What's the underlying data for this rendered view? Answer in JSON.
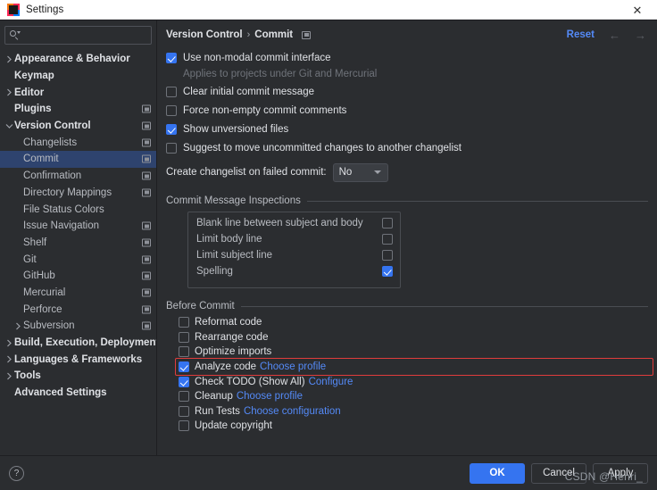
{
  "window": {
    "title": "Settings",
    "close_icon": "close-icon",
    "app_icon": "intellij-idea-icon"
  },
  "search": {
    "placeholder": "",
    "value": "",
    "icon": "search-icon"
  },
  "sidebar": {
    "items": [
      {
        "label": "Appearance & Behavior",
        "level": 0,
        "arrow": "right",
        "bold": true,
        "config_icon": false,
        "selected": false
      },
      {
        "label": "Keymap",
        "level": 0,
        "arrow": "none",
        "bold": true,
        "config_icon": false,
        "selected": false
      },
      {
        "label": "Editor",
        "level": 0,
        "arrow": "right",
        "bold": true,
        "config_icon": false,
        "selected": false
      },
      {
        "label": "Plugins",
        "level": 0,
        "arrow": "none",
        "bold": true,
        "config_icon": true,
        "selected": false
      },
      {
        "label": "Version Control",
        "level": 0,
        "arrow": "down",
        "bold": true,
        "config_icon": true,
        "selected": false
      },
      {
        "label": "Changelists",
        "level": 1,
        "arrow": "none",
        "bold": false,
        "config_icon": true,
        "selected": false
      },
      {
        "label": "Commit",
        "level": 1,
        "arrow": "none",
        "bold": false,
        "config_icon": true,
        "selected": true
      },
      {
        "label": "Confirmation",
        "level": 1,
        "arrow": "none",
        "bold": false,
        "config_icon": true,
        "selected": false
      },
      {
        "label": "Directory Mappings",
        "level": 1,
        "arrow": "none",
        "bold": false,
        "config_icon": true,
        "selected": false
      },
      {
        "label": "File Status Colors",
        "level": 1,
        "arrow": "none",
        "bold": false,
        "config_icon": false,
        "selected": false
      },
      {
        "label": "Issue Navigation",
        "level": 1,
        "arrow": "none",
        "bold": false,
        "config_icon": true,
        "selected": false
      },
      {
        "label": "Shelf",
        "level": 1,
        "arrow": "none",
        "bold": false,
        "config_icon": true,
        "selected": false
      },
      {
        "label": "Git",
        "level": 1,
        "arrow": "none",
        "bold": false,
        "config_icon": true,
        "selected": false
      },
      {
        "label": "GitHub",
        "level": 1,
        "arrow": "none",
        "bold": false,
        "config_icon": true,
        "selected": false
      },
      {
        "label": "Mercurial",
        "level": 1,
        "arrow": "none",
        "bold": false,
        "config_icon": true,
        "selected": false
      },
      {
        "label": "Perforce",
        "level": 1,
        "arrow": "none",
        "bold": false,
        "config_icon": true,
        "selected": false
      },
      {
        "label": "Subversion",
        "level": 1,
        "arrow": "right",
        "bold": false,
        "config_icon": true,
        "selected": false
      },
      {
        "label": "Build, Execution, Deployment",
        "level": 0,
        "arrow": "right",
        "bold": true,
        "config_icon": false,
        "selected": false
      },
      {
        "label": "Languages & Frameworks",
        "level": 0,
        "arrow": "right",
        "bold": true,
        "config_icon": false,
        "selected": false
      },
      {
        "label": "Tools",
        "level": 0,
        "arrow": "right",
        "bold": true,
        "config_icon": false,
        "selected": false
      },
      {
        "label": "Advanced Settings",
        "level": 0,
        "arrow": "none",
        "bold": true,
        "config_icon": false,
        "selected": false
      }
    ]
  },
  "main": {
    "breadcrumb": {
      "parent": "Version Control",
      "separator": "›",
      "current": "Commit"
    },
    "reset_label": "Reset",
    "back_arrow": "←",
    "forward_arrow": "→",
    "options": [
      {
        "label": "Use non-modal commit interface",
        "checked": true,
        "note": "Applies to projects under Git and Mercurial"
      },
      {
        "label": "Clear initial commit message",
        "checked": false,
        "note": ""
      },
      {
        "label": "Force non-empty commit comments",
        "checked": false,
        "note": ""
      },
      {
        "label": "Show unversioned files",
        "checked": true,
        "note": ""
      },
      {
        "label": "Suggest to move uncommitted changes to another changelist",
        "checked": false,
        "note": ""
      }
    ],
    "changelist": {
      "label": "Create changelist on failed commit:",
      "value": "No"
    },
    "inspections": {
      "title": "Commit Message Inspections",
      "rows": [
        {
          "name": "Blank line between subject and body",
          "checked": false
        },
        {
          "name": "Limit body line",
          "checked": false
        },
        {
          "name": "Limit subject line",
          "checked": false
        },
        {
          "name": "Spelling",
          "checked": true
        }
      ]
    },
    "before_commit": {
      "title": "Before Commit",
      "items": [
        {
          "label": "Reformat code",
          "checked": false,
          "link": "",
          "highlighted": false
        },
        {
          "label": "Rearrange code",
          "checked": false,
          "link": "",
          "highlighted": false
        },
        {
          "label": "Optimize imports",
          "checked": false,
          "link": "",
          "highlighted": false
        },
        {
          "label": "Analyze code",
          "checked": true,
          "link": "Choose profile",
          "highlighted": true
        },
        {
          "label": "Check TODO (Show All)",
          "checked": true,
          "link": "Configure",
          "highlighted": false
        },
        {
          "label": "Cleanup",
          "checked": false,
          "link": "Choose profile",
          "highlighted": false
        },
        {
          "label": "Run Tests",
          "checked": false,
          "link": "Choose configuration",
          "highlighted": false
        },
        {
          "label": "Update copyright",
          "checked": false,
          "link": "",
          "highlighted": false
        }
      ]
    }
  },
  "footer": {
    "help_label": "?",
    "ok_label": "OK",
    "cancel_label": "Cancel",
    "apply_label": "Apply"
  },
  "watermark": {
    "text": "CSDN @Henri_"
  },
  "colors": {
    "accent": "#3574f0",
    "link": "#548af7",
    "selection": "#2e436e",
    "background": "#2b2d30",
    "highlight_outline": "#e03c3c"
  }
}
